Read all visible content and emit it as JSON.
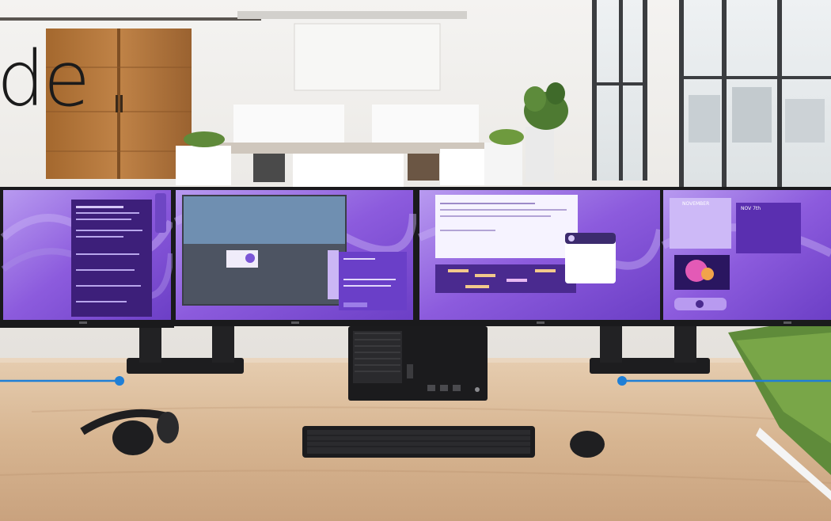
{
  "headline": "de",
  "monitor4": {
    "calendar_month": "NOVEMBER",
    "side_panel_title": "NOV 7th"
  },
  "colors": {
    "wall": "#f2f1ee",
    "desk": "#d9b996",
    "screen_purple": "#8e5fdc",
    "callout_line": "#1f7fd6",
    "pc_black": "#1b1b1d"
  }
}
